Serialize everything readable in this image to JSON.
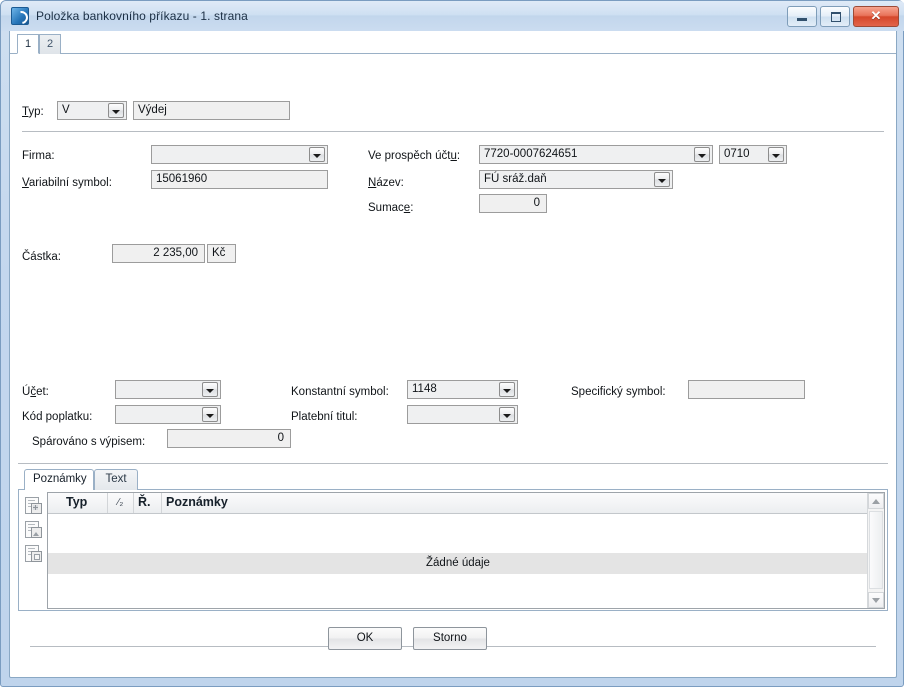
{
  "window": {
    "title": "Položka bankovního příkazu - 1. strana",
    "app_icon": "app-icon",
    "minimize_label": "",
    "maximize_label": "",
    "close_label": "✕"
  },
  "page_tabs": [
    {
      "label": "1",
      "active": true
    },
    {
      "label": "2",
      "active": false
    }
  ],
  "form": {
    "typ": {
      "label": "Typ:",
      "code_value": "V",
      "text_value": "Výdej"
    },
    "firma": {
      "label": "Firma:",
      "value": ""
    },
    "variabilni_symbol": {
      "label": "Variabilní symbol:",
      "value": "15061960"
    },
    "ve_prospech_uctu": {
      "label": "Ve prospěch účtu:",
      "value": "7720-0007624651",
      "bank_code": "0710"
    },
    "nazev": {
      "label": "Název:",
      "value": "FÚ sráž.daň"
    },
    "sumace": {
      "label": "Sumace:",
      "value": "0"
    },
    "castka": {
      "label": "Částka:",
      "value": "2 235,00",
      "currency": "Kč"
    },
    "ucet": {
      "label": "Účet:",
      "value": ""
    },
    "kod_poplatku": {
      "label": "Kód poplatku:",
      "value": ""
    },
    "sparovano": {
      "label": "Spárováno s výpisem:",
      "value": "0"
    },
    "konstantni_symbol": {
      "label": "Konstantní symbol:",
      "value": "1148"
    },
    "platebni_titul": {
      "label": "Platební titul:",
      "value": ""
    },
    "specificky_symbol": {
      "label": "Specifický symbol:",
      "value": ""
    }
  },
  "notes_panel": {
    "tabs": [
      {
        "label": "Poznámky",
        "active": true
      },
      {
        "label": "Text",
        "active": false
      }
    ],
    "toolbar_icons": [
      "document-grid-icon",
      "document-image-icon",
      "document-copy-icon"
    ],
    "grid": {
      "columns": [
        "Typ",
        "⁄₂",
        "Ř.",
        "Poznámky"
      ],
      "empty_message": "Žádné údaje",
      "rows": []
    }
  },
  "buttons": {
    "ok": "OK",
    "cancel": "Storno"
  }
}
